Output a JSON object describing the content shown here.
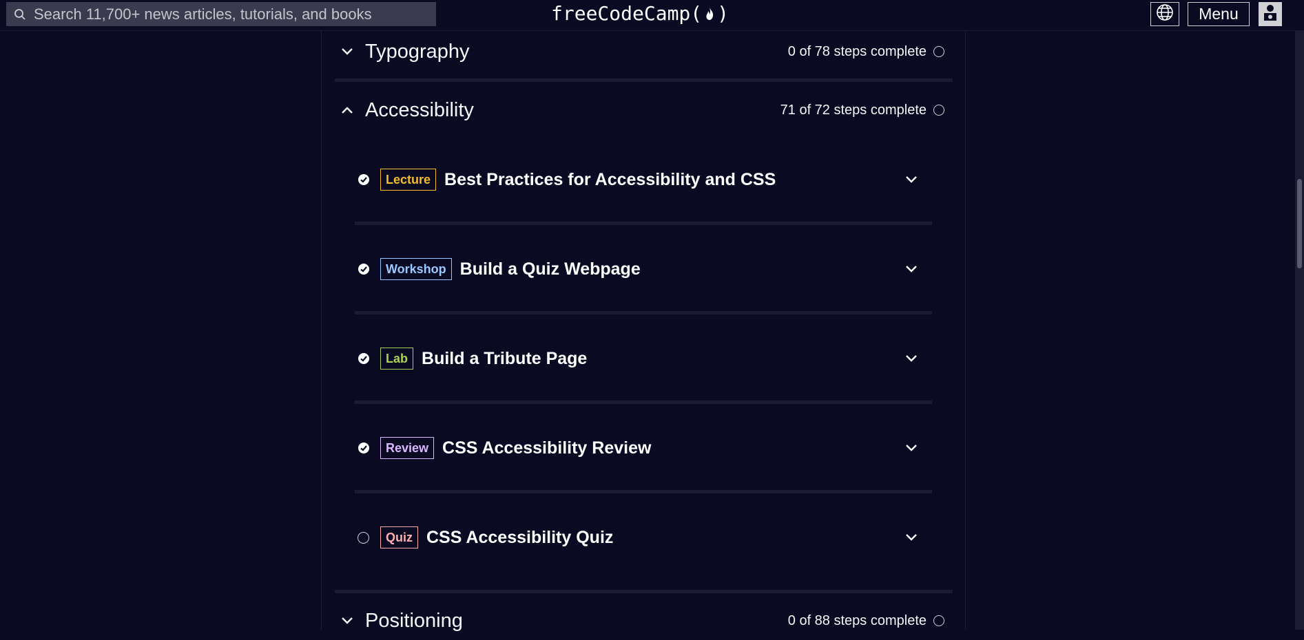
{
  "search": {
    "placeholder": "Search 11,700+ news articles, tutorials, and books"
  },
  "logo": {
    "text_left": "freeCodeCamp(",
    "text_right": ")"
  },
  "nav": {
    "menu_label": "Menu"
  },
  "blocks": [
    {
      "title": "Typography",
      "progress": "0 of 78 steps complete",
      "expanded": false
    },
    {
      "title": "Accessibility",
      "progress": "71 of 72 steps complete",
      "expanded": true
    },
    {
      "title": "Positioning",
      "progress": "0 of 88 steps complete",
      "expanded": false
    }
  ],
  "items": [
    {
      "type": "Lecture",
      "name": "Best Practices for Accessibility and CSS",
      "completed": true
    },
    {
      "type": "Workshop",
      "name": "Build a Quiz Webpage",
      "completed": true
    },
    {
      "type": "Lab",
      "name": "Build a Tribute Page",
      "completed": true
    },
    {
      "type": "Review",
      "name": "CSS Accessibility Review",
      "completed": true
    },
    {
      "type": "Quiz",
      "name": "CSS Accessibility Quiz",
      "completed": false
    }
  ],
  "colors": {
    "background": "#0a0a23",
    "separator": "#1b1b32",
    "lecture": "#f1be32",
    "workshop": "#99c9ff",
    "lab": "#acd157",
    "review": "#dbb8ff",
    "quiz": "#ffadad"
  },
  "icons": {
    "search": "magnifier-icon",
    "language": "globe-icon",
    "avatar": "user-avatar-icon",
    "expand": "chevron-down-icon",
    "collapse": "chevron-up-icon",
    "complete": "check-circle-icon",
    "incomplete": "empty-circle-icon"
  }
}
